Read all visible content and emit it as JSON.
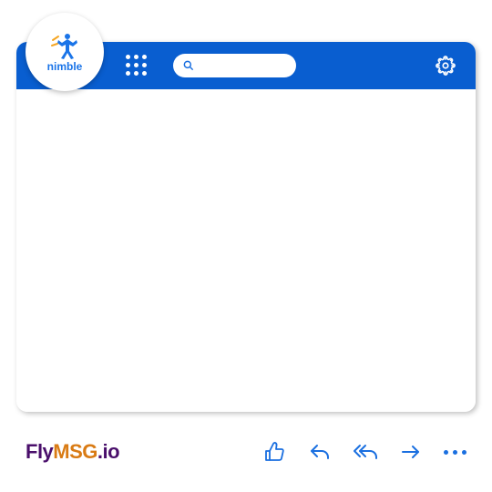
{
  "brand_logo": {
    "name": "nimble"
  },
  "header": {
    "search_placeholder": ""
  },
  "icons": {
    "apps": "apps-grid-icon",
    "search": "search-icon",
    "settings": "gear-icon",
    "like": "thumbs-up-icon",
    "reply": "reply-icon",
    "reply_all": "reply-all-icon",
    "forward": "forward-arrow-icon",
    "more": "more-dots-icon"
  },
  "footer": {
    "brand_part_1": "Fly",
    "brand_part_2": "MSG",
    "brand_part_3": ".io"
  },
  "colors": {
    "primary": "#095ed0",
    "action": "#1a6fe0",
    "brand_purple": "#4a0f6b",
    "brand_orange": "#d97b14"
  }
}
